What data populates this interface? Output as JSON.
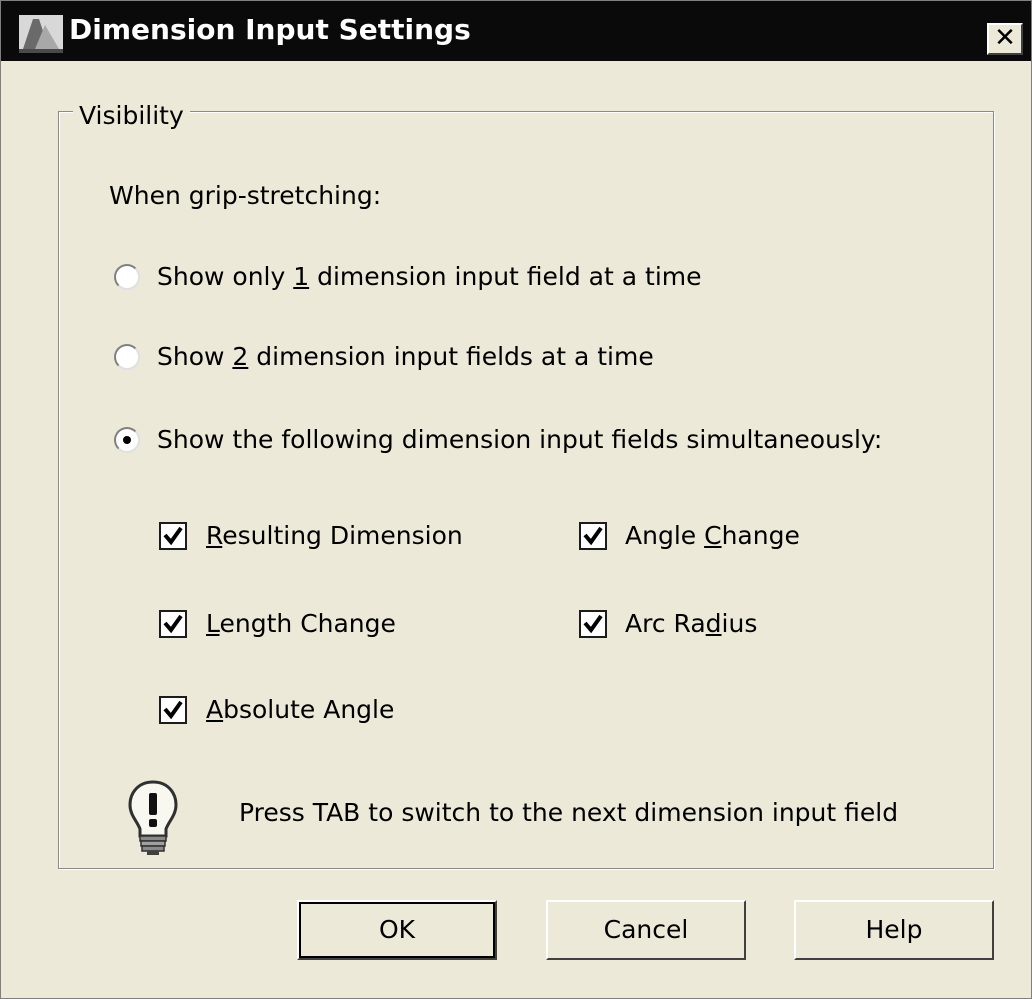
{
  "window": {
    "title": "Dimension Input Settings",
    "close_label": "✕"
  },
  "group": {
    "legend": "Visibility",
    "prompt": "When grip-stretching:"
  },
  "radios": [
    {
      "prefix": "Show only ",
      "mnemonic": "1",
      "suffix": " dimension input field at a time",
      "selected": false
    },
    {
      "prefix": "Show ",
      "mnemonic": "2",
      "suffix": " dimension input fields at a time",
      "selected": false
    },
    {
      "prefix": "Show the following dimension input fields simultaneously:",
      "mnemonic": "",
      "suffix": "",
      "selected": true
    }
  ],
  "checkboxes": {
    "resulting_dimension": {
      "mnemonic": "R",
      "rest": "esulting Dimension",
      "checked": true
    },
    "angle_change": {
      "before": "Angle ",
      "mnemonic": "C",
      "rest": "hange",
      "checked": true
    },
    "length_change": {
      "mnemonic": "L",
      "rest": "ength Change",
      "checked": true
    },
    "arc_radius": {
      "before": "Arc Ra",
      "mnemonic": "d",
      "rest": "ius",
      "checked": true
    },
    "absolute_angle": {
      "mnemonic": "A",
      "rest": "bsolute Angle",
      "checked": true
    }
  },
  "hint": {
    "icon": "lightbulb-icon",
    "text": "Press TAB to switch to the next dimension input field"
  },
  "buttons": {
    "ok": "OK",
    "cancel": "Cancel",
    "help": "Help"
  }
}
